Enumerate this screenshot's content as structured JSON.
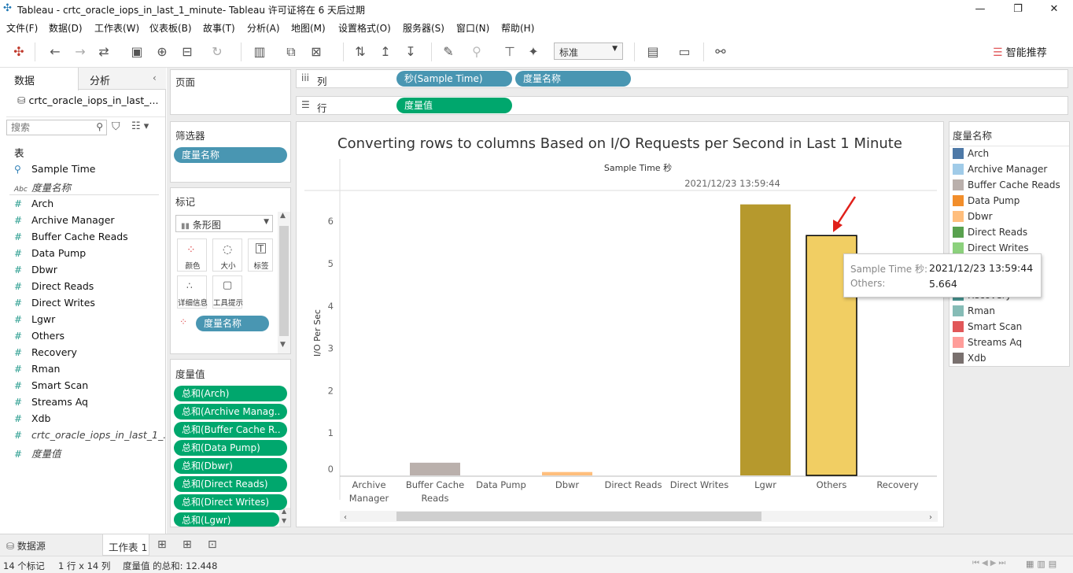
{
  "window": {
    "title": "Tableau - crtc_oracle_iops_in_last_1_minute- Tableau 许可证将在 6 天后过期"
  },
  "menu": [
    "文件(F)",
    "数据(D)",
    "工作表(W)",
    "仪表板(B)",
    "故事(T)",
    "分析(A)",
    "地图(M)",
    "设置格式(O)",
    "服务器(S)",
    "窗口(N)",
    "帮助(H)"
  ],
  "toolbar": {
    "fit_select": "标准",
    "smart_recommend": "智能推荐"
  },
  "left_pane": {
    "tabs": [
      "数据",
      "分析"
    ],
    "datasource": "crtc_oracle_iops_in_last_...",
    "search_placeholder": "搜索",
    "section_title": "表",
    "dimensions": [
      {
        "label": "Sample Time",
        "icon": "calendar-icon"
      },
      {
        "label": "度量名称",
        "icon": "abc-icon"
      }
    ],
    "measures": [
      "Arch",
      "Archive Manager",
      "Buffer Cache Reads",
      "Data Pump",
      "Dbwr",
      "Direct Reads",
      "Direct Writes",
      "Lgwr",
      "Others",
      "Recovery",
      "Rman",
      "Smart Scan",
      "Streams Aq",
      "Xdb",
      "crtc_oracle_iops_in_last_1_...",
      "度量值"
    ]
  },
  "shelves": {
    "pages": "页面",
    "filters": "筛选器",
    "filter_pill": "度量名称",
    "marks": "标记",
    "mark_type": "条形图",
    "mark_buttons": [
      "颜色",
      "大小",
      "标签",
      "详细信息",
      "工具提示"
    ],
    "marks_pill": "度量名称",
    "measure_values_title": "度量值",
    "measure_values": [
      "总和(Arch)",
      "总和(Archive Manag..",
      "总和(Buffer Cache R..",
      "总和(Data Pump)",
      "总和(Dbwr)",
      "总和(Direct Reads)",
      "总和(Direct Writes)",
      "总和(Lgwr)"
    ],
    "columns_label": "列",
    "columns": [
      "秒(Sample Time)",
      "度量名称"
    ],
    "rows_label": "行",
    "rows": [
      "度量值"
    ]
  },
  "chart_data": {
    "type": "bar",
    "title": "Converting rows to columns Based on I/O Requests per Second in Last 1 Minute",
    "header_field": "Sample Time 秒",
    "header_value": "2021/12/23 13:59:44",
    "ylabel": "I/O Per Sec",
    "ylim": [
      0,
      7
    ],
    "yticks": [
      0,
      1,
      2,
      3,
      4,
      5,
      6
    ],
    "categories": [
      "Archive\nManager",
      "Buffer Cache\nReads",
      "Data Pump",
      "Dbwr",
      "Direct Reads",
      "Direct Writes",
      "Lgwr",
      "Others",
      "Recovery"
    ],
    "values": [
      0,
      0.3,
      0,
      0.08,
      0,
      0,
      6.4,
      5.664,
      0
    ],
    "colors": [
      "#a0cbe8",
      "#bab0ac",
      "#f28e2b",
      "#ffbe7d",
      "#59a14f",
      "#8cd17d",
      "#b6992d",
      "#f1ce63",
      "#499894"
    ],
    "selected": "Others",
    "grid": false
  },
  "legend": {
    "title": "度量名称",
    "items": [
      {
        "label": "Arch",
        "color": "#4e79a7"
      },
      {
        "label": "Archive Manager",
        "color": "#a0cbe8"
      },
      {
        "label": "Buffer Cache Reads",
        "color": "#bab0ac"
      },
      {
        "label": "Data Pump",
        "color": "#f28e2b"
      },
      {
        "label": "Dbwr",
        "color": "#ffbe7d"
      },
      {
        "label": "Direct Reads",
        "color": "#59a14f"
      },
      {
        "label": "Direct Writes",
        "color": "#8cd17d"
      },
      {
        "label": "Recovery",
        "color": "#499894"
      },
      {
        "label": "Rman",
        "color": "#86bcb6"
      },
      {
        "label": "Smart Scan",
        "color": "#e15759"
      },
      {
        "label": "Streams Aq",
        "color": "#ff9d9a"
      },
      {
        "label": "Xdb",
        "color": "#79706e"
      }
    ]
  },
  "tooltip": {
    "k1": "Sample Time 秒:",
    "v1": "2021/12/23 13:59:44",
    "k2": "Others:",
    "v2": "5.664"
  },
  "sheets": {
    "datasource_tab": "数据源",
    "sheet": "工作表 1"
  },
  "status": {
    "marks": "14 个标记",
    "rows_cols": "1 行 x 14 列",
    "sum": "度量值 的总和: 12.448"
  }
}
